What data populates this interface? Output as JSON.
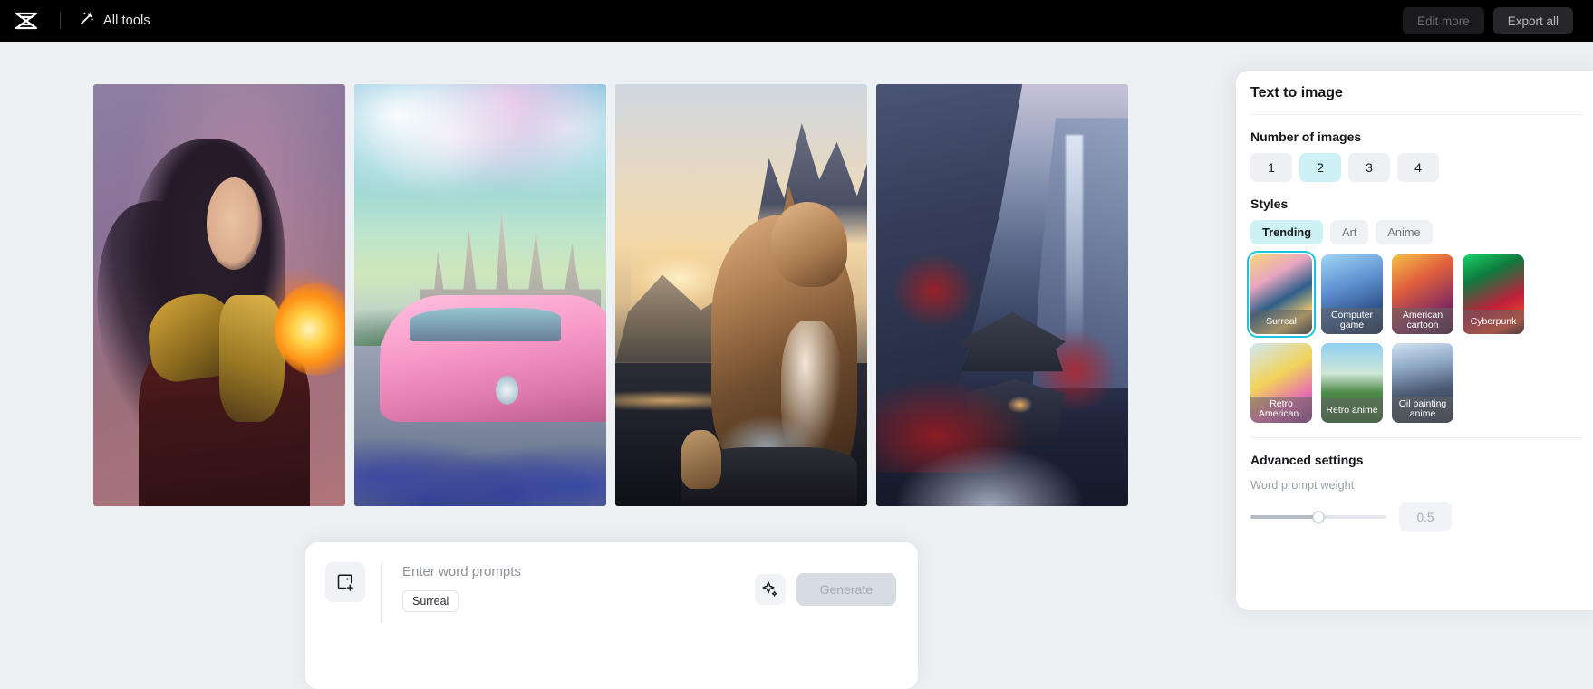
{
  "topbar": {
    "logo_icon": "capcut-logo-icon",
    "tools_icon": "magic-wand-icon",
    "all_tools_label": "All tools",
    "edit_more_label": "Edit more",
    "export_all_label": "Export all"
  },
  "gallery": {
    "images": [
      {
        "alt": "Fantasy warrior woman in gold armor with fireball"
      },
      {
        "alt": "Pink vintage car on cobblestone path before fairytale castle"
      },
      {
        "alt": "Tabby cat sitting at golden sunset by a mountain lake"
      },
      {
        "alt": "Japanese pagoda temple in a dark red-foliage mountain valley"
      }
    ]
  },
  "prompt": {
    "add_image_icon": "add-image-icon",
    "placeholder": "Enter word prompts",
    "value": "",
    "chips": [
      "Surreal"
    ],
    "sparkle_icon": "sparkle-icon",
    "generate_label": "Generate"
  },
  "panel": {
    "title": "Text to image",
    "number_of_images": {
      "label": "Number of images",
      "options": [
        "1",
        "2",
        "3",
        "4"
      ],
      "selected": "2"
    },
    "styles": {
      "label": "Styles",
      "tabs": [
        "Trending",
        "Art",
        "Anime"
      ],
      "selected_tab": "Trending",
      "items": [
        {
          "name": "Surreal",
          "selected": true
        },
        {
          "name": "Computer game",
          "selected": false
        },
        {
          "name": "American cartoon",
          "selected": false
        },
        {
          "name": "Cyberpunk",
          "selected": false
        },
        {
          "name": "Retro American..",
          "selected": false
        },
        {
          "name": "Retro anime",
          "selected": false
        },
        {
          "name": "Oil painting anime",
          "selected": false
        }
      ]
    },
    "advanced": {
      "label": "Advanced settings",
      "weight_label": "Word prompt weight",
      "weight_value": "0.5"
    }
  },
  "colors": {
    "accent": "#18c4e0",
    "accent_soft": "#cdf1f5",
    "canvas_bg": "#eef1f4",
    "topbar_bg": "#000000"
  }
}
